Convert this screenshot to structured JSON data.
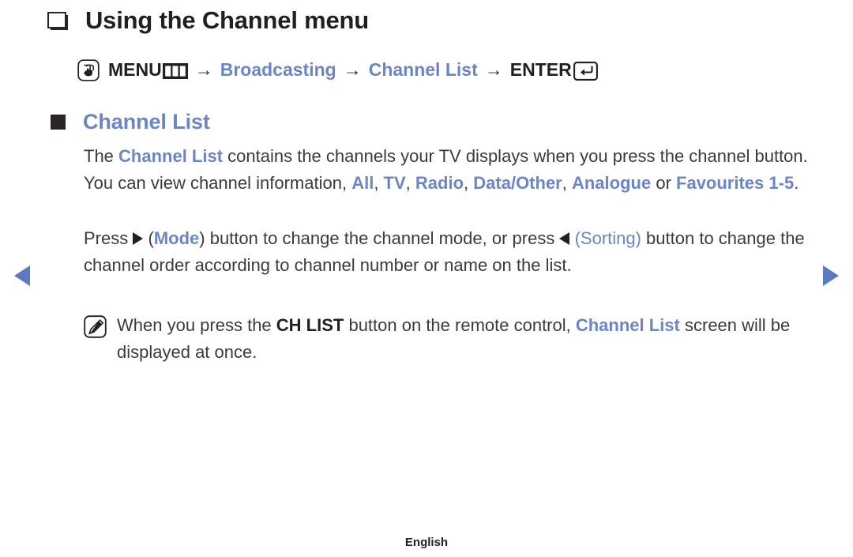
{
  "title": {
    "bullet_icon": "outlined-square-bullet-icon",
    "text": "Using the Channel menu"
  },
  "breadcrumb": {
    "touch_icon": "hand-touch-icon",
    "menu_label": "MENU",
    "menu_icon": "menu-grid-icon",
    "arrow": "→",
    "step2": "Broadcasting",
    "step3": "Channel List",
    "enter_label": "ENTER",
    "enter_icon": "enter-key-icon"
  },
  "section": {
    "bullet_icon": "filled-square-bullet-icon",
    "title": "Channel List"
  },
  "paragraph1": {
    "t1": "The ",
    "t2": "Channel List",
    "t3": " contains the channels your TV displays when you press the channel button. You can view channel information, ",
    "t4": "All",
    "t5": ", ",
    "t6": "TV",
    "t7": ", ",
    "t8": "Radio",
    "t9": ", ",
    "t10": "Data/Other",
    "t11": ", ",
    "t12": "Analogue",
    "t13": " or ",
    "t14": "Favourites 1-5",
    "t15": "."
  },
  "paragraph2": {
    "t1": "Press ",
    "icon_right": "triangle-right-icon",
    "t2": " (",
    "t3": "Mode",
    "t4": ") button to change the channel mode, or press ",
    "icon_left": "triangle-left-icon",
    "t5": " ",
    "t6": "(Sorting)",
    "t7": " button to change the channel order according to channel number or name on the list."
  },
  "note": {
    "icon": "note-pencil-icon",
    "t1": "When you press the ",
    "t2": "CH LIST",
    "t3": " button on the remote control, ",
    "t4": "Channel List",
    "t5": " screen will be displayed at once."
  },
  "navigation": {
    "prev_icon": "previous-page-arrow-icon",
    "next_icon": "next-page-arrow-icon"
  },
  "footer": {
    "language": "English"
  },
  "colors": {
    "accent_blue": "#6b85c6",
    "nav_blue": "#5c7ac0",
    "text_dark": "#231f20",
    "body_text": "#3b3b3b",
    "background": "#ffffff"
  }
}
